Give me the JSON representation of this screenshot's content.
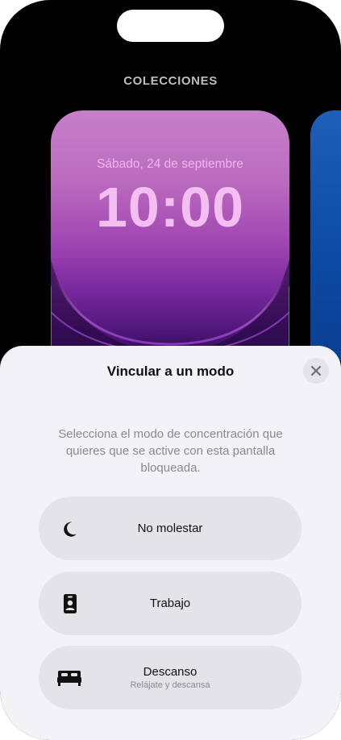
{
  "header": {
    "section_title": "COLECCIONES"
  },
  "wallpaper": {
    "date": "Sábado, 24 de septiembre",
    "time": "10:00"
  },
  "sheet": {
    "title": "Vincular a un modo",
    "close_icon": "close-icon",
    "description": "Selecciona el modo de concentración que quieres que se active con esta pantalla bloqueada.",
    "options": [
      {
        "label": "No molestar",
        "subtitle": "",
        "icon": "moon-icon"
      },
      {
        "label": "Trabajo",
        "subtitle": "",
        "icon": "id-badge-icon"
      },
      {
        "label": "Descanso",
        "subtitle": "Relájate y descansa",
        "icon": "bed-icon"
      }
    ]
  },
  "colors": {
    "sheet_bg": "#f2f2f7",
    "option_bg": "#e3e3e8",
    "secondary_text": "#8a8a8e",
    "wallpaper_text": "#f3bff0"
  }
}
